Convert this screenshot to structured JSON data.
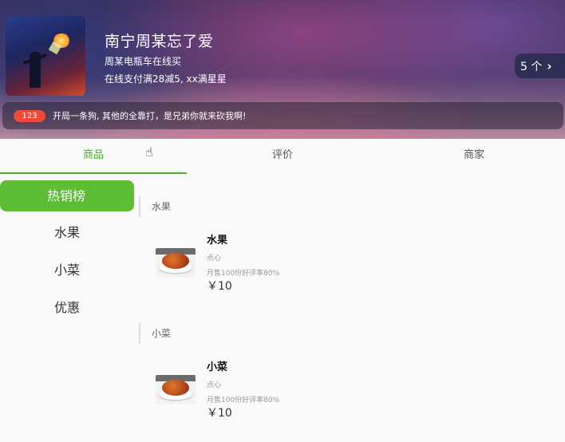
{
  "header": {
    "title": "南宁周某忘了爱",
    "description": "周某电瓶车在线买",
    "promotion": "在线支付满28减5, xx满星星",
    "count_button": "5 个",
    "notice": {
      "badge": "123",
      "text": "开局一条狗, 其他的全靠打，是兄弟你就来砍我啊!"
    }
  },
  "tabs": [
    {
      "label": "商品",
      "active": true
    },
    {
      "label": "评价",
      "active": false
    },
    {
      "label": "商家",
      "active": false
    }
  ],
  "sidebar": {
    "items": [
      {
        "label": "热销榜",
        "active": true
      },
      {
        "label": "水果",
        "active": false
      },
      {
        "label": "小菜",
        "active": false
      },
      {
        "label": "优惠",
        "active": false
      }
    ]
  },
  "sections": [
    {
      "title": "水果",
      "items": [
        {
          "name": "水果",
          "category": "点心",
          "sales": "月售100份好评率80%",
          "price": "￥10"
        }
      ]
    },
    {
      "title": "小菜",
      "items": [
        {
          "name": "小菜",
          "category": "点心",
          "sales": "月售100份好评率80%",
          "price": "￥10"
        }
      ]
    }
  ],
  "colors": {
    "accent": "#5cbd34",
    "tab_active": "#4cb031",
    "badge": "#ef4a3a"
  }
}
